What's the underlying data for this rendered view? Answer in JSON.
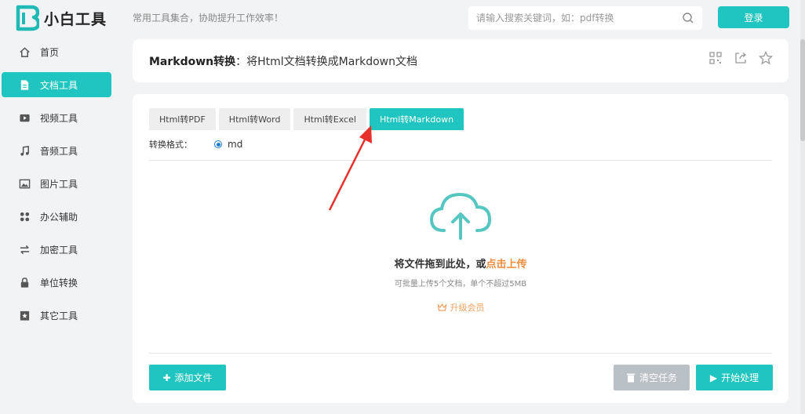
{
  "brand": {
    "name": "小白工具",
    "accent": "#20c4c0"
  },
  "header": {
    "slogan": "常用工具集合，协助提升工作效率！",
    "search_placeholder": "请输入搜索关键词，如：pdf转换",
    "login_label": "登录"
  },
  "sidebar": {
    "items": [
      {
        "label": "首页",
        "icon": "home-icon"
      },
      {
        "label": "文档工具",
        "icon": "document-icon",
        "active": true
      },
      {
        "label": "视频工具",
        "icon": "video-icon"
      },
      {
        "label": "音频工具",
        "icon": "music-icon"
      },
      {
        "label": "图片工具",
        "icon": "image-icon"
      },
      {
        "label": "办公辅助",
        "icon": "apps-icon"
      },
      {
        "label": "加密工具",
        "icon": "swap-icon"
      },
      {
        "label": "单位转换",
        "icon": "lock-icon"
      },
      {
        "label": "其它工具",
        "icon": "bookmark-icon"
      }
    ]
  },
  "title": {
    "main": "Markdown转换",
    "sub": "：将Html文档转换成Markdown文档"
  },
  "tabs": [
    {
      "label": "Html转PDF"
    },
    {
      "label": "Html转Word"
    },
    {
      "label": "Html转Excel"
    },
    {
      "label": "Html转Markdown",
      "active": true
    }
  ],
  "format": {
    "label": "转换格式：",
    "value": "md"
  },
  "upload": {
    "drop_text": "将文件拖到此处，或",
    "drop_link": "点击上传",
    "hint": "可批量上传5个文档，单个不超过5MB",
    "upgrade": "升级会员"
  },
  "actions": {
    "add": "添加文件",
    "clear": "清空任务",
    "start": "开始处理"
  }
}
